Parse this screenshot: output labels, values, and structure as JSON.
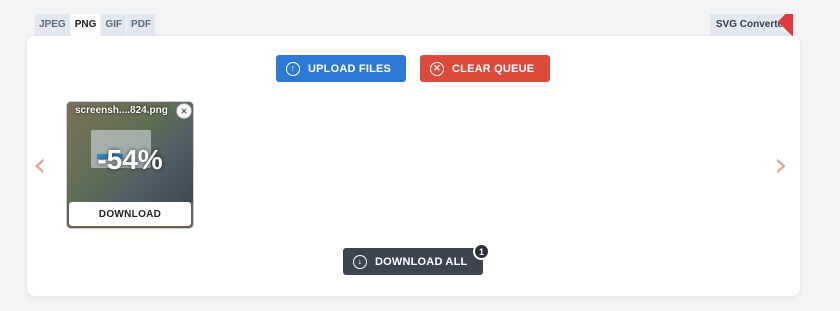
{
  "tabs": [
    "JPEG",
    "PNG",
    "GIF",
    "PDF"
  ],
  "svg_converter": "SVG Converter",
  "buttons": {
    "upload": "UPLOAD FILES",
    "clear": "CLEAR QUEUE",
    "download_all": "DOWNLOAD ALL"
  },
  "download_all_count": "1",
  "file": {
    "name": "screensh....824.png",
    "savings": "-54%",
    "download": "DOWNLOAD"
  },
  "nav": {
    "prev": "‹",
    "next": "›"
  },
  "colors": {
    "upload": "#2e79d6",
    "clear": "#db4a3b",
    "download_all": "#3b4450",
    "arrows": "#e0a898"
  },
  "icons": {
    "upload": "upload-arrow-icon",
    "clear": "clear-x-icon",
    "download": "download-arrow-icon",
    "close": "close-icon"
  }
}
